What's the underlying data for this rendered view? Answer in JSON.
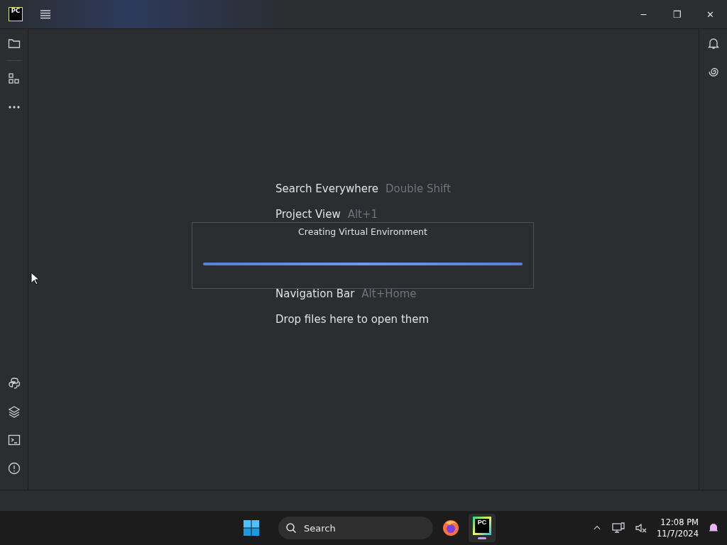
{
  "title_bar": {
    "logo": "PC",
    "window_controls": [
      "─",
      "❐",
      "✕"
    ]
  },
  "hints": [
    {
      "action": "Search Everywhere",
      "shortcut": "Double Shift"
    },
    {
      "action": "Project View",
      "shortcut": "Alt+1"
    },
    {
      "action": "Navigation Bar",
      "shortcut": "Alt+Home"
    },
    {
      "action": "Drop files here to open them"
    }
  ],
  "progress_dialog": {
    "title": "Creating Virtual Environment",
    "level": 1
  },
  "taskbar": {
    "search": {
      "placeholder": "Search"
    },
    "app_logo": "PC",
    "time": "12:08 PM",
    "date": "11/7/2024"
  }
}
